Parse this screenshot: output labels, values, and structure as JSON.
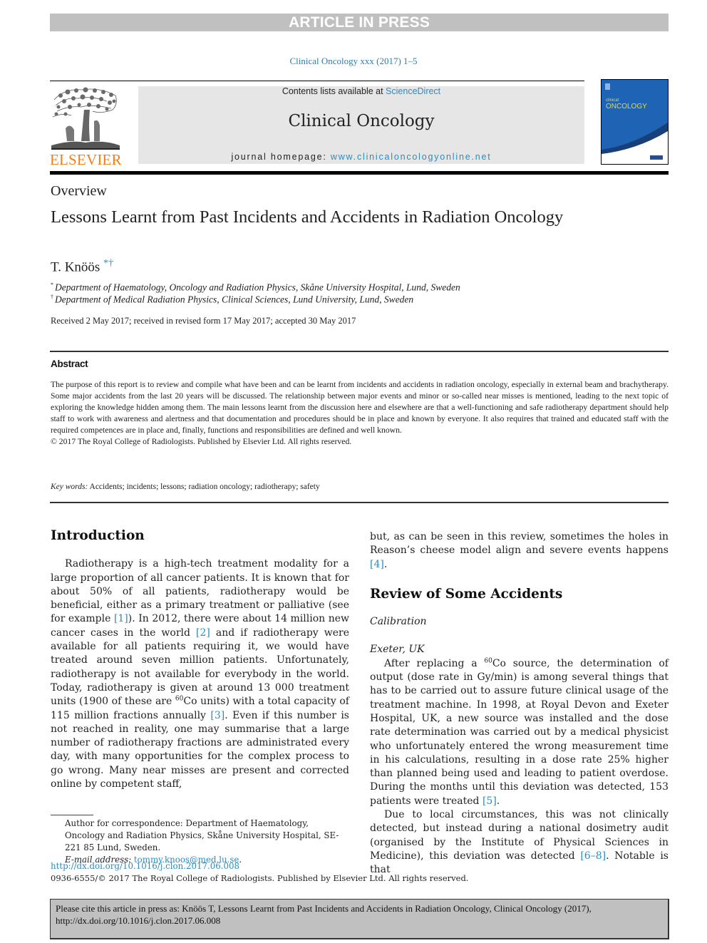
{
  "banner": {
    "text": "ARTICLE IN PRESS"
  },
  "journal_ref": "Clinical Oncology xxx (2017) 1–5",
  "header": {
    "publisher_logo_text": "ELSEVIER",
    "contents_prefix": "Contents lists available at ",
    "contents_link": "ScienceDirect",
    "journal_title": "Clinical Oncology",
    "homepage_prefix": "journal homepage: ",
    "homepage_link": "www.clinicaloncologyonline.net",
    "cover": {
      "title_small": "clinical",
      "title_large": "ONCOLOGY",
      "colors": {
        "blue": "#1f63b5",
        "dark_blue": "#173f7a",
        "title": "#e6d84a"
      }
    }
  },
  "article": {
    "section_label": "Overview",
    "title": "Lessons Learnt from Past Incidents and Accidents in Radiation Oncology",
    "author": {
      "name": "T. Knöös",
      "marks": "*†"
    },
    "affiliations": [
      {
        "mark": "*",
        "text": "Department of Haematology, Oncology and Radiation Physics, Skåne University Hospital, Lund, Sweden"
      },
      {
        "mark": "†",
        "text": "Department of Medical Radiation Physics, Clinical Sciences, Lund University, Lund, Sweden"
      }
    ],
    "received": "Received 2 May 2017; received in revised form 17 May 2017; accepted 30 May 2017"
  },
  "abstract": {
    "heading": "Abstract",
    "text": "The purpose of this report is to review and compile what have been and can be learnt from incidents and accidents in radiation oncology, especially in external beam and brachytherapy. Some major accidents from the last 20 years will be discussed. The relationship between major events and minor or so-called near misses is mentioned, leading to the next topic of exploring the knowledge hidden among them. The main lessons learnt from the discussion here and elsewhere are that a well-functioning and safe radiotherapy department should help staff to work with awareness and alertness and that documentation and procedures should be in place and known by everyone. It also requires that trained and educated staff with the required competences are in place and, finally, functions and responsibilities are defined and well known.",
    "copyright": "© 2017 The Royal College of Radiologists. Published by Elsevier Ltd. All rights reserved.",
    "keywords_label": "Key words:",
    "keywords": " Accidents; incidents; lessons; radiation oncology; radiotherapy; safety"
  },
  "body": {
    "intro": {
      "heading": "Introduction",
      "p1_a": "Radiotherapy is a high-tech treatment modality for a large proportion of all cancer patients. It is known that for about 50% of all patients, radiotherapy would be beneficial, either as a primary treatment or palliative (see for example ",
      "ref1": "[1]",
      "p1_b": "). In 2012, there were about 14 million new cancer cases in the world ",
      "ref2": "[2]",
      "p1_c": " and if radiotherapy were available for all patients requiring it, we would have treated around seven million patients. Unfortunately, radiotherapy is not available for everybody in the world. Today, radiotherapy is given at around 13 000 treatment units (1900 of these are ",
      "sup60": "60",
      "p1_d": "Co units) with a total capacity of 115 million fractions annually ",
      "ref3": "[3]",
      "p1_e": ". Even if this number is not reached in reality, one may summarise that a large number of radiotherapy fractions are administrated every day, with many opportunities for the complex process to go wrong. Many near misses are present and corrected online by competent staff,"
    },
    "col2": {
      "p_cont_a": "but, as can be seen in this review, sometimes the holes in Reason’s cheese model align and severe events happens ",
      "ref4": "[4]",
      "p_cont_b": ".",
      "heading": "Review of Some Accidents",
      "subhead1": "Calibration",
      "subhead2": "Exeter, UK",
      "p2_a": "After replacing a ",
      "sup60": "60",
      "p2_b": "Co source, the determination of output (dose rate in Gy/min) is among several things that has to be carried out to assure future clinical usage of the treatment machine. In 1998, at Royal Devon and Exeter Hospital, UK, a new source was installed and the dose rate determination was carried out by a medical physicist who unfortunately entered the wrong measurement time in his calculations, resulting in a dose rate 25% higher than planned being used and leading to patient overdose. During the months until this deviation was detected, 153 patients were treated ",
      "ref5": "[5]",
      "p2_c": ".",
      "p3_a": "Due to local circumstances, this was not clinically detected, but instead during a national dosimetry audit (organised by the Institute of Physical Sciences in Medicine), this deviation was detected ",
      "ref6": "[6–8]",
      "p3_b": ". Notable is that"
    }
  },
  "footnote": {
    "correspondence": "Author for correspondence: Department of Haematology, Oncology and Radiation Physics, Skåne University Hospital, SE-221 85 Lund, Sweden.",
    "email_label": "E-mail address: ",
    "email": "tommy.knoos@med.lu.se",
    "email_suffix": "."
  },
  "doi": "http://dx.doi.org/10.1016/j.clon.2017.06.008",
  "issn_line": "0936-6555/© 2017 The Royal College of Radiologists. Published by Elsevier Ltd. All rights reserved.",
  "citation": {
    "line1": "Please cite this article in press as: Knöös T, Lessons Learnt from Past Incidents and Accidents in Radiation Oncology, Clinical Oncology (2017),",
    "line2": "http://dx.doi.org/10.1016/j.clon.2017.06.008"
  }
}
